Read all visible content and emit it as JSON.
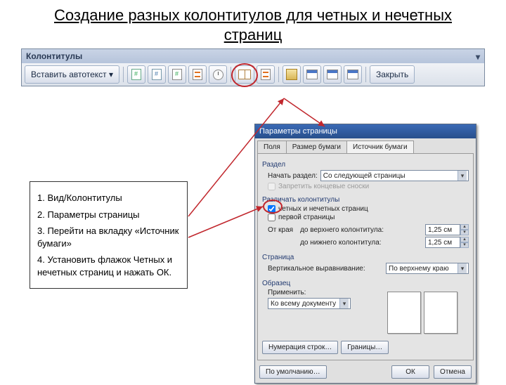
{
  "title": "Создание разных колонтитулов для четных и нечетных страниц",
  "toolbar": {
    "window_title": "Колонтитулы",
    "autotext": "Вставить автотекст ▾",
    "close": "Закрыть"
  },
  "instructions": {
    "s1": "1. Вид/Колонтитулы",
    "s2": "2. Параметры страницы",
    "s3": "3. Перейти на вкладку «Источник бумаги»",
    "s4": "4. Установить флажок Четных и нечетных страниц и нажать ОК."
  },
  "dialog": {
    "title": "Параметры страницы",
    "tabs": {
      "t1": "Поля",
      "t2": "Размер бумаги",
      "t3": "Источник бумаги"
    },
    "section": {
      "label": "Раздел",
      "start_label": "Начать раздел:",
      "start_value": "Со следующей страницы",
      "suppress": "Запретить концевые сноски"
    },
    "headers": {
      "label": "Различать колонтитулы",
      "odd_even": "четных и нечетных страниц",
      "first": "первой страницы",
      "edge_label": "От края",
      "top_label": "до верхнего колонтитула:",
      "top_val": "1,25 см",
      "bot_label": "до нижнего колонтитула:",
      "bot_val": "1,25 см"
    },
    "page": {
      "label": "Страница",
      "valign_label": "Вертикальное выравнивание:",
      "valign_value": "По верхнему краю"
    },
    "preview": {
      "label": "Образец",
      "apply_label": "Применить:",
      "apply_value": "Ко всему документу"
    },
    "btn_lines": "Нумерация строк…",
    "btn_borders": "Границы…",
    "btn_default": "По умолчанию…",
    "btn_ok": "ОК",
    "btn_cancel": "Отмена"
  }
}
